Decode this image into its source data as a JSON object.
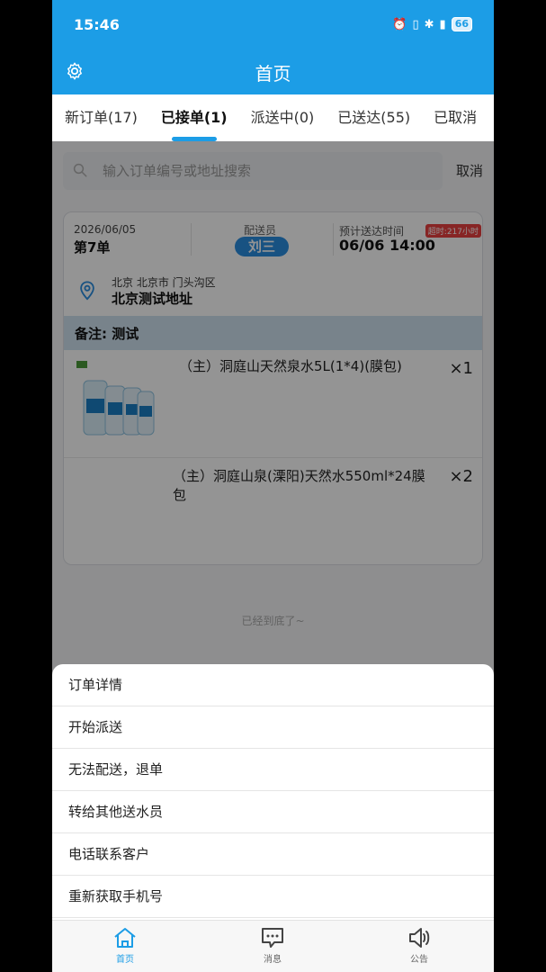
{
  "status_bar": {
    "time": "15:46",
    "battery": "66"
  },
  "header": {
    "title": "首页"
  },
  "tabs": [
    {
      "label": "新订单(17)"
    },
    {
      "label": "已接单(1)"
    },
    {
      "label": "派送中(0)"
    },
    {
      "label": "已送达(55)"
    },
    {
      "label": "已取消"
    }
  ],
  "search": {
    "placeholder": "输入订单编号或地址搜索",
    "cancel": "取消"
  },
  "order": {
    "date": "2026/06/05",
    "number": "第7单",
    "courier_label": "配送员",
    "courier_name": "刘三",
    "eta_label": "预计送达时间",
    "eta_value": "06/06 14:00",
    "overdue": "超时:217小时",
    "address_region": "北京 北京市 门头沟区",
    "address_detail": "北京测试地址",
    "remark": "备注: 测试",
    "items": [
      {
        "name": "（主）洞庭山天然泉水5L(1*4)(膜包)",
        "qty": "×1"
      },
      {
        "name": "（主）洞庭山泉(溧阳)天然水550ml*24膜包",
        "qty": "×2"
      }
    ]
  },
  "list_end": "已经到底了~",
  "action_sheet": [
    {
      "label": "订单详情"
    },
    {
      "label": "开始派送"
    },
    {
      "label": "无法配送，退单"
    },
    {
      "label": "转给其他送水员"
    },
    {
      "label": "电话联系客户"
    },
    {
      "label": "重新获取手机号"
    }
  ],
  "bottom_nav": [
    {
      "label": "首页",
      "icon": "home-icon"
    },
    {
      "label": "消息",
      "icon": "message-icon"
    },
    {
      "label": "公告",
      "icon": "speaker-icon"
    }
  ],
  "colors": {
    "primary": "#1c9de6",
    "overdue": "#e84040",
    "remark_bg": "#cfe2f0"
  }
}
